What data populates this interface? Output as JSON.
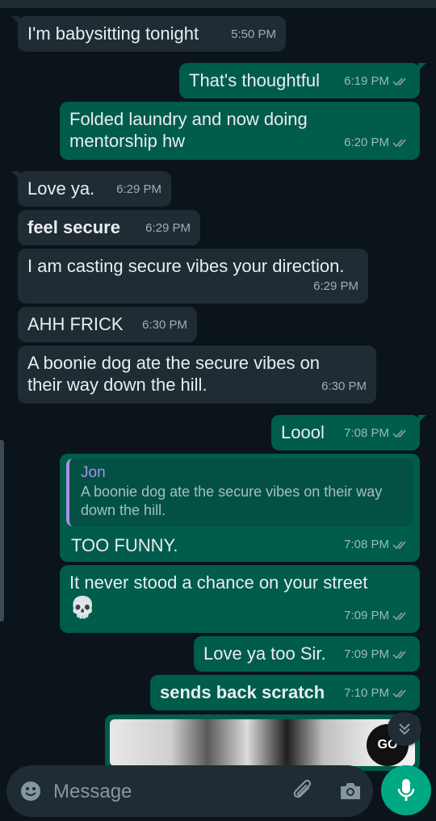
{
  "messages": [
    {
      "text": "I'm babysitting tonight",
      "time": "5:50 PM"
    },
    {
      "text": "That's thoughtful",
      "time": "6:19 PM"
    },
    {
      "text": "Folded laundry and now doing mentorship hw",
      "time": "6:20 PM"
    },
    {
      "text": "Love ya.",
      "time": "6:29 PM"
    },
    {
      "text": "feel secure",
      "time": "6:29 PM"
    },
    {
      "text": "I am casting secure vibes your direction.",
      "time": "6:29 PM"
    },
    {
      "text": "AHH FRICK",
      "time": "6:30 PM"
    },
    {
      "text": "A boonie dog ate the secure vibes on their way down the hill.",
      "time": "6:30 PM"
    },
    {
      "text": "Loool",
      "time": "7:08 PM"
    },
    {
      "quote_author": "Jon",
      "quote_text": "A boonie dog ate the secure vibes on their way down the hill.",
      "text": "TOO FUNNY.",
      "time": "7:08 PM"
    },
    {
      "text": "It never stood a chance on your street",
      "emoji": "💀",
      "time": "7:09 PM"
    },
    {
      "text": "Love ya too Sir.",
      "time": "7:09 PM"
    },
    {
      "text": "sends back scratch",
      "time": "7:10 PM"
    }
  ],
  "composer": {
    "placeholder": "Message"
  },
  "icons": {
    "emoji": "emoji-icon",
    "attach": "paperclip-icon",
    "camera": "camera-icon",
    "mic": "mic-icon",
    "scroll_down": "double-chevron-down-icon",
    "read_receipt": "double-check-icon"
  },
  "colors": {
    "background": "#0b141a",
    "incoming_bubble": "#1f2c34",
    "outgoing_bubble": "#005c4b",
    "accent": "#00a884",
    "quote_author": "#a592e6",
    "read_ticks": "#8696a0"
  }
}
